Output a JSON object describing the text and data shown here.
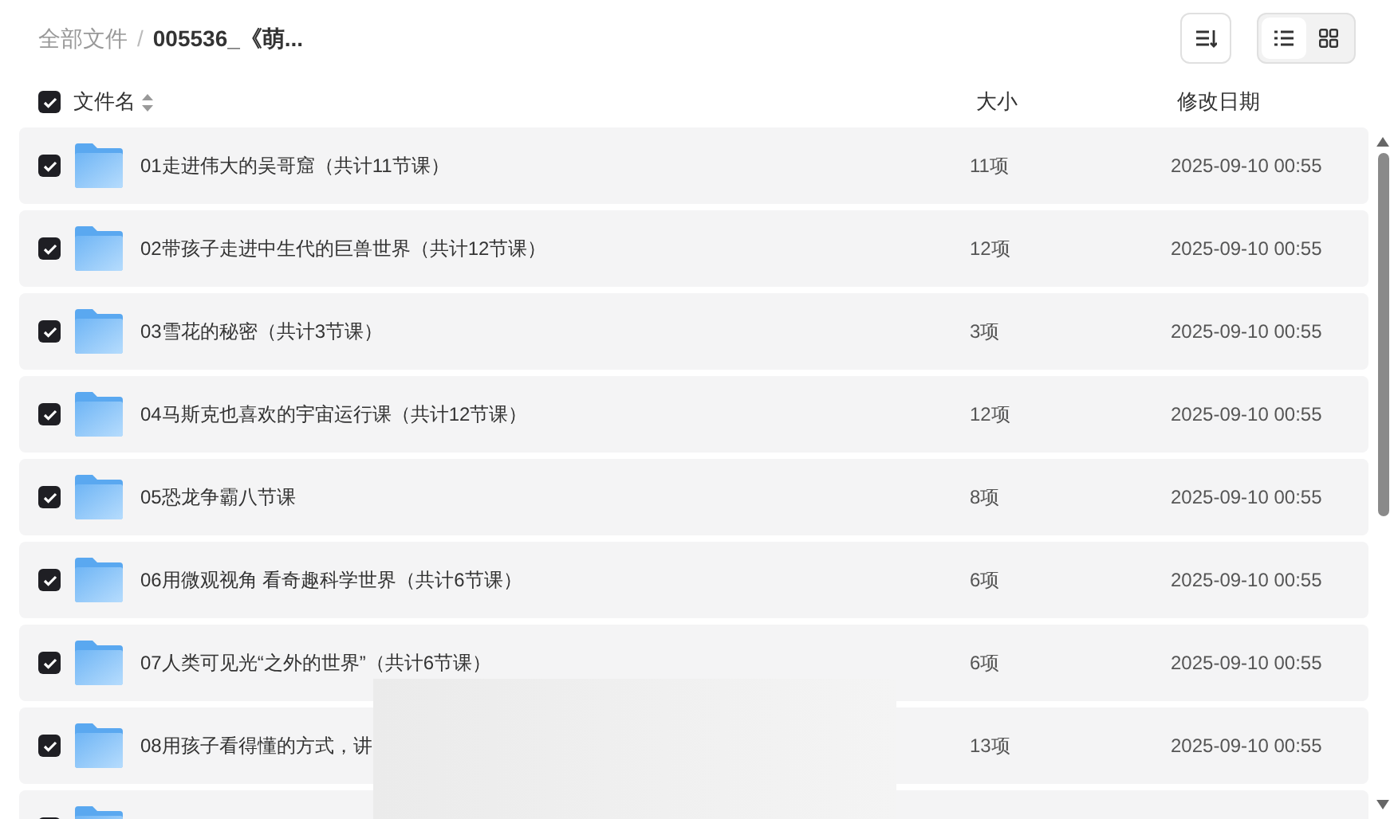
{
  "breadcrumb_separator": "/",
  "breadcrumb": [
    {
      "label": "全部文件",
      "current": false
    },
    {
      "label": "005536_《萌...",
      "current": true
    }
  ],
  "view_modes": [
    {
      "kind": "list",
      "selected": true
    },
    {
      "kind": "grid",
      "selected": false
    }
  ],
  "columns": {
    "name": "文件名",
    "size": "大小",
    "modified": "修改日期",
    "all_checked": true
  },
  "rows": [
    {
      "name": "01走进伟大的吴哥窟（共计11节课）",
      "size": "11项",
      "modified": "2025-09-10 00:55",
      "checked": true
    },
    {
      "name": "02带孩子走进中生代的巨兽世界（共计12节课）",
      "size": "12项",
      "modified": "2025-09-10 00:55",
      "checked": true
    },
    {
      "name": "03雪花的秘密（共计3节课）",
      "size": "3项",
      "modified": "2025-09-10 00:55",
      "checked": true
    },
    {
      "name": "04马斯克也喜欢的宇宙运行课（共计12节课）",
      "size": "12项",
      "modified": "2025-09-10 00:55",
      "checked": true
    },
    {
      "name": "05恐龙争霸八节课",
      "size": "8项",
      "modified": "2025-09-10 00:55",
      "checked": true
    },
    {
      "name": "06用微观视角 看奇趣科学世界（共计6节课）",
      "size": "6项",
      "modified": "2025-09-10 00:55",
      "checked": true
    },
    {
      "name": "07人类可见光“之外的世界”（共计6节课）",
      "size": "6项",
      "modified": "2025-09-10 00:55",
      "checked": true
    },
    {
      "name": "08用孩子看得懂的方式，讲",
      "size": "13项",
      "modified": "2025-09-10 00:55",
      "checked": true
    },
    {
      "checked": true
    }
  ]
}
